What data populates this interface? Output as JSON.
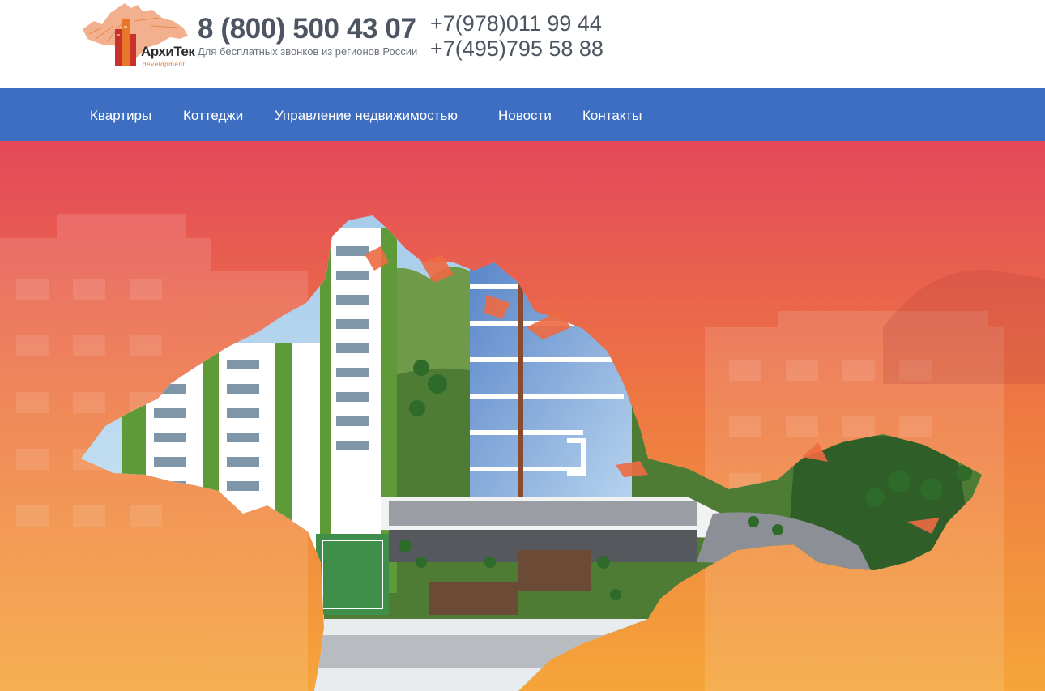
{
  "logo": {
    "name": "АрхиТек",
    "sub": "development"
  },
  "contacts": {
    "main_phone": "8 (800) 500 43 07",
    "main_phone_note": "Для бесплатных звонков из регионов России",
    "phones": [
      "+7(978)011 99 44",
      "+7(495)795 58 88"
    ]
  },
  "nav": {
    "items": [
      "Квартиры",
      "Коттеджи",
      "Управление недвижимостью",
      "Новости",
      "Контакты"
    ]
  },
  "colors": {
    "nav_background": "#3d6ec2",
    "phone_text": "#4c5561",
    "brand_orange": "#e8772a",
    "brand_red": "#c8322a",
    "hero_gradient_top": "#e4485a",
    "hero_gradient_bottom": "#f5a53a"
  }
}
